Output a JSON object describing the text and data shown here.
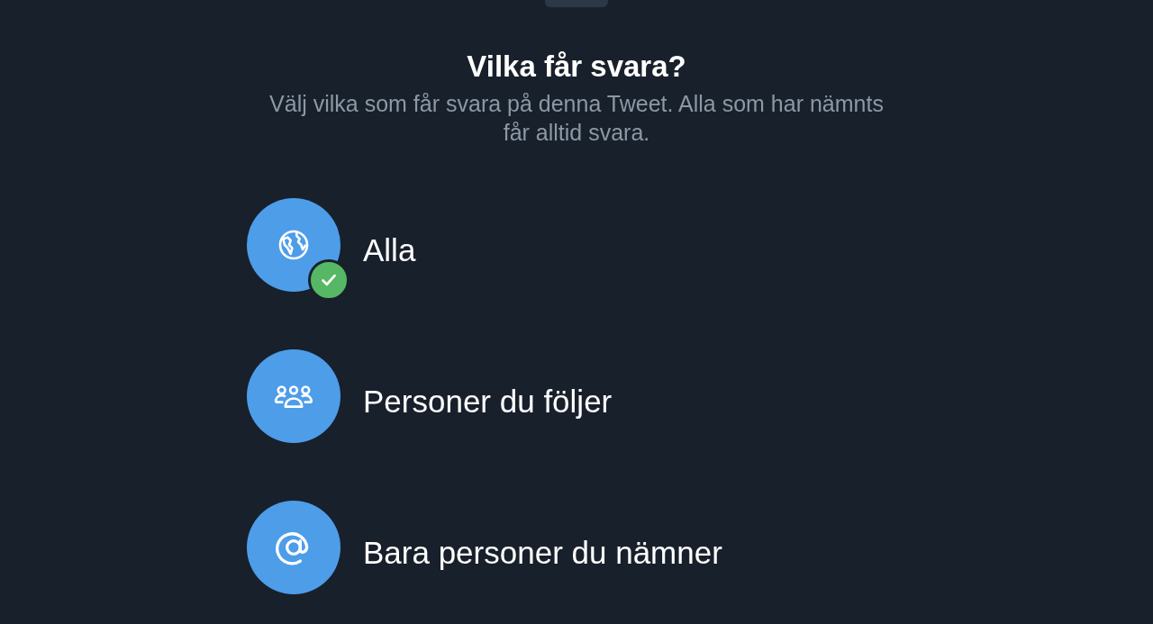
{
  "title": "Vilka får svara?",
  "subtitle": "Välj vilka som får svara på denna Tweet. Alla som har nämnts får alltid svara.",
  "options": [
    {
      "kind": "globe",
      "label": "Alla",
      "selected": true
    },
    {
      "kind": "people",
      "label": "Personer du följer",
      "selected": false
    },
    {
      "kind": "mention",
      "label": "Bara personer du nämner",
      "selected": false
    }
  ]
}
